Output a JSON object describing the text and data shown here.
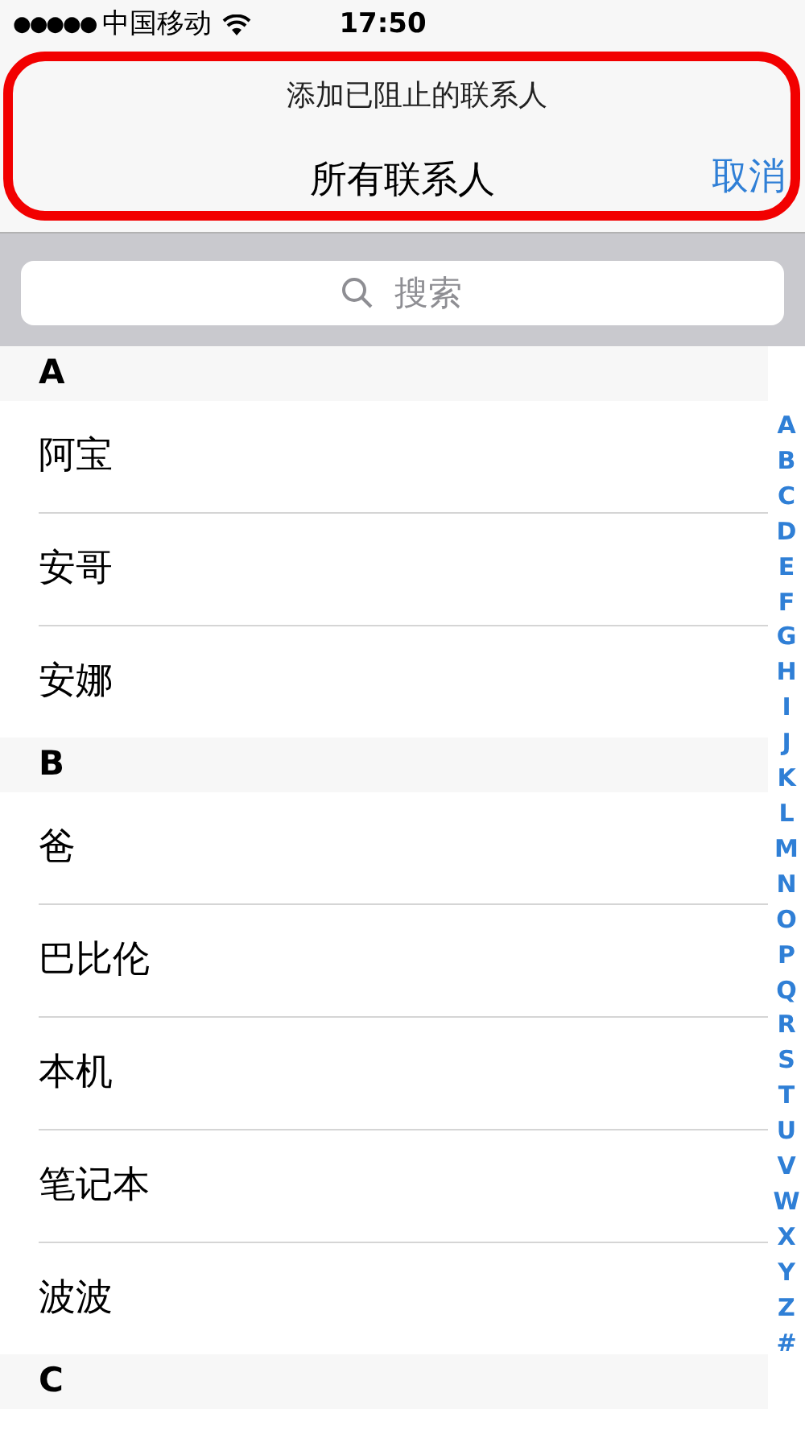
{
  "status_bar": {
    "signal": "●●●●●",
    "carrier": "中国移动",
    "time": "17:50"
  },
  "nav": {
    "prompt": "添加已阻止的联系人",
    "title": "所有联系人",
    "cancel": "取消"
  },
  "search": {
    "placeholder": "搜索"
  },
  "sections": [
    {
      "letter": "A",
      "contacts": [
        "阿宝",
        "安哥",
        "安娜"
      ]
    },
    {
      "letter": "B",
      "contacts": [
        "爸",
        "巴比伦",
        "本机",
        "笔记本",
        "波波"
      ]
    },
    {
      "letter": "C"
    }
  ],
  "index": [
    "A",
    "B",
    "C",
    "D",
    "E",
    "F",
    "G",
    "H",
    "I",
    "J",
    "K",
    "L",
    "M",
    "N",
    "O",
    "P",
    "Q",
    "R",
    "S",
    "T",
    "U",
    "V",
    "W",
    "X",
    "Y",
    "Z",
    "#"
  ]
}
